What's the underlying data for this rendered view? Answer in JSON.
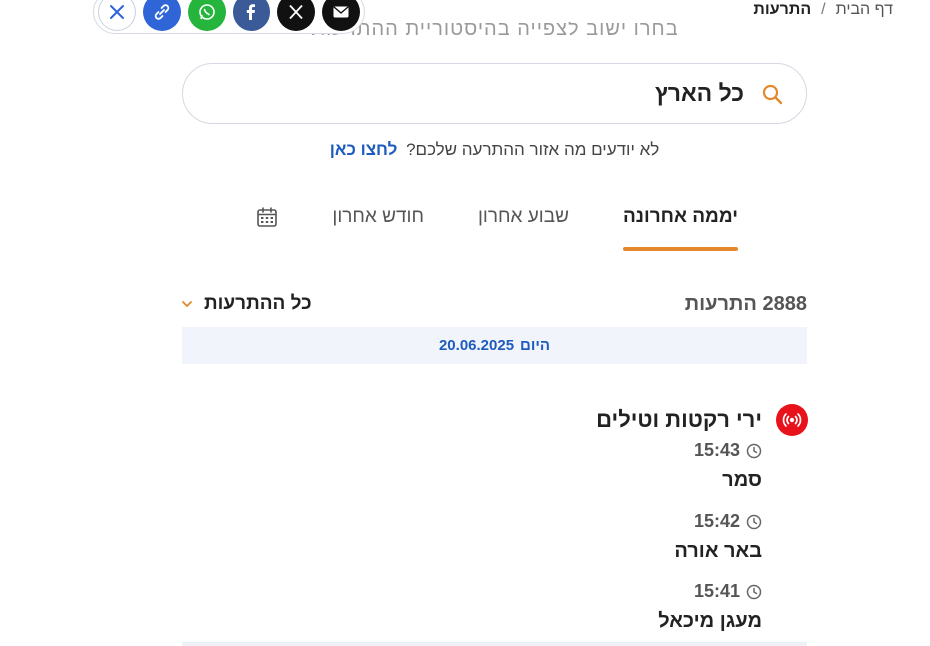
{
  "breadcrumb": {
    "home": "דף הבית",
    "separator": "/",
    "current": "התרעות"
  },
  "ghost_subtitle": "בחרו ישוב לצפייה בהיסטוריית ההתרעות",
  "share": {
    "icons": [
      "close-icon",
      "link-icon",
      "whatsapp-icon",
      "facebook-icon",
      "x-icon",
      "mail-icon"
    ]
  },
  "search": {
    "value": "כל הארץ",
    "icon": "search-icon"
  },
  "hint": {
    "text": "לא יודעים מה אזור ההתרעה שלכם?",
    "link": "לחצו כאן"
  },
  "tabs": [
    {
      "label": "יממה אחרונה",
      "active": true
    },
    {
      "label": "שבוע אחרון",
      "active": false
    },
    {
      "label": "חודש אחרון",
      "active": false
    }
  ],
  "count_label": "2888 התרעות",
  "filter_label": "כל ההתרעות",
  "date_bar": {
    "day": "היום",
    "date": "20.06.2025"
  },
  "alert_group": {
    "title": "ירי רקטות וטילים",
    "items": [
      {
        "time": "15:43",
        "place": "סמר"
      },
      {
        "time": "15:42",
        "place": "באר אורה"
      },
      {
        "time": "15:41",
        "place": "מעגן מיכאל"
      }
    ]
  },
  "colors": {
    "accent": "#e3892b",
    "link": "#1d5bbf",
    "alert_red": "#e8121b",
    "date_bar_bg": "#f1f4fa"
  }
}
